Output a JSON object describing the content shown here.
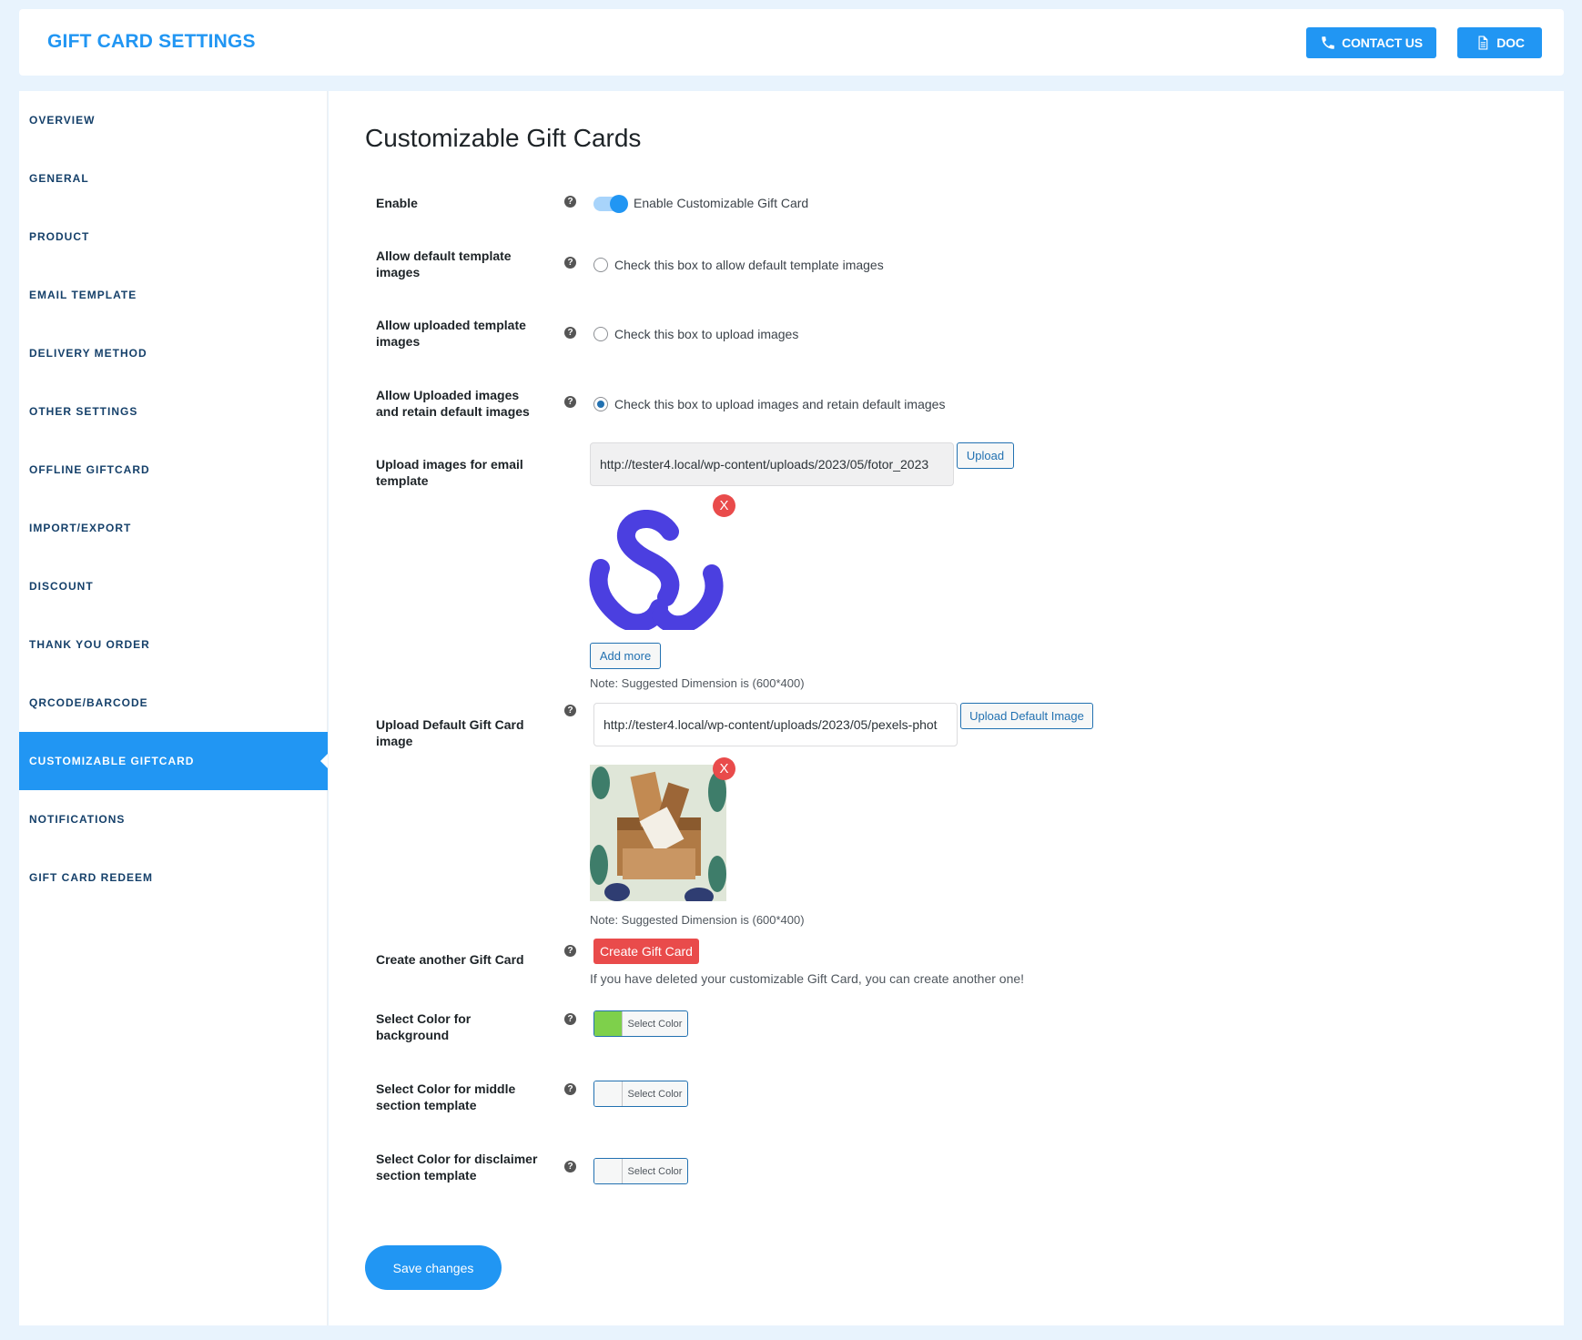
{
  "header": {
    "title": "GIFT CARD SETTINGS",
    "contact_label": "CONTACT US",
    "doc_label": "DOC"
  },
  "sidebar": {
    "items": [
      {
        "label": "OVERVIEW"
      },
      {
        "label": "GENERAL"
      },
      {
        "label": "PRODUCT"
      },
      {
        "label": "EMAIL TEMPLATE"
      },
      {
        "label": "DELIVERY METHOD"
      },
      {
        "label": "OTHER SETTINGS"
      },
      {
        "label": "OFFLINE GIFTCARD"
      },
      {
        "label": "IMPORT/EXPORT"
      },
      {
        "label": "DISCOUNT"
      },
      {
        "label": "THANK YOU ORDER"
      },
      {
        "label": "QRCODE/BARCODE"
      },
      {
        "label": "CUSTOMIZABLE GIFTCARD"
      },
      {
        "label": "NOTIFICATIONS"
      },
      {
        "label": "GIFT CARD REDEEM"
      }
    ],
    "active_index": 11
  },
  "main": {
    "title": "Customizable Gift Cards",
    "enable": {
      "label": "Enable",
      "text": "Enable Customizable Gift Card",
      "on": true
    },
    "allow_default": {
      "label": "Allow default template images",
      "text": "Check this box to allow default template images",
      "checked": false
    },
    "allow_uploaded": {
      "label": "Allow uploaded template images",
      "text": "Check this box to upload images",
      "checked": false
    },
    "allow_retain": {
      "label": "Allow Uploaded images and retain default images",
      "text": "Check this box to upload images and retain default images",
      "checked": true
    },
    "upload_email": {
      "label": "Upload images for email template",
      "value": "http://tester4.local/wp-content/uploads/2023/05/fotor_2023",
      "button": "Upload",
      "remove": "X",
      "add_more": "Add more",
      "note": "Note: Suggested Dimension is (600*400)"
    },
    "upload_default": {
      "label": "Upload Default Gift Card image",
      "value": "http://tester4.local/wp-content/uploads/2023/05/pexels-phot",
      "button": "Upload Default Image",
      "remove": "X",
      "note": "Note: Suggested Dimension is (600*400)"
    },
    "create_another": {
      "label": "Create another Gift Card",
      "button": "Create Gift Card",
      "hint": "If you have deleted your customizable Gift Card, you can create another one!"
    },
    "color_background": {
      "label": "Select Color for background",
      "button": "Select Color",
      "color": "#7ed04b"
    },
    "color_middle": {
      "label": "Select Color for middle section template",
      "button": "Select Color",
      "color": "#f6f7f7"
    },
    "color_disclaimer": {
      "label": "Select Color for disclaimer section template",
      "button": "Select Color",
      "color": "#f6f7f7"
    },
    "save_label": "Save changes"
  },
  "colors": {
    "accent": "#2196f3",
    "danger": "#e94b4b",
    "logo": "#4b3fe0"
  },
  "help_glyph": "?"
}
